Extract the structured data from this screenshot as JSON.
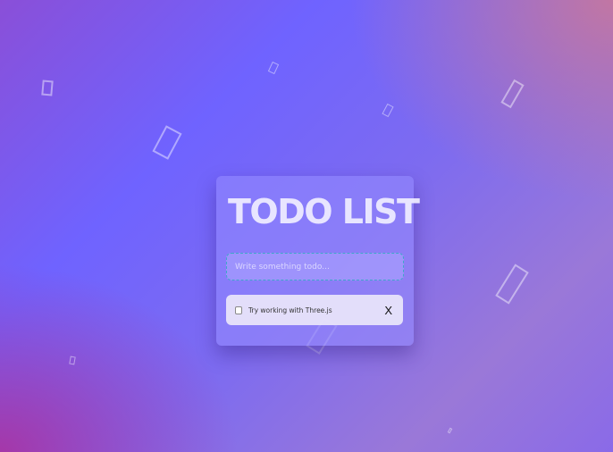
{
  "app": {
    "title": "TODO LIST"
  },
  "input": {
    "placeholder": "Write something todo...",
    "value": ""
  },
  "todos": [
    {
      "text": "Try working with Three.js",
      "checked": false,
      "delete_label": "X"
    }
  ],
  "colors": {
    "background_mid": "#6f63ff",
    "background_corner_top_right": "#cd7896",
    "background_corner_bottom_left": "#aa32a0",
    "card": "#968cff",
    "input_border": "#3fa7c9",
    "todo_item": "#e8e4fa"
  }
}
